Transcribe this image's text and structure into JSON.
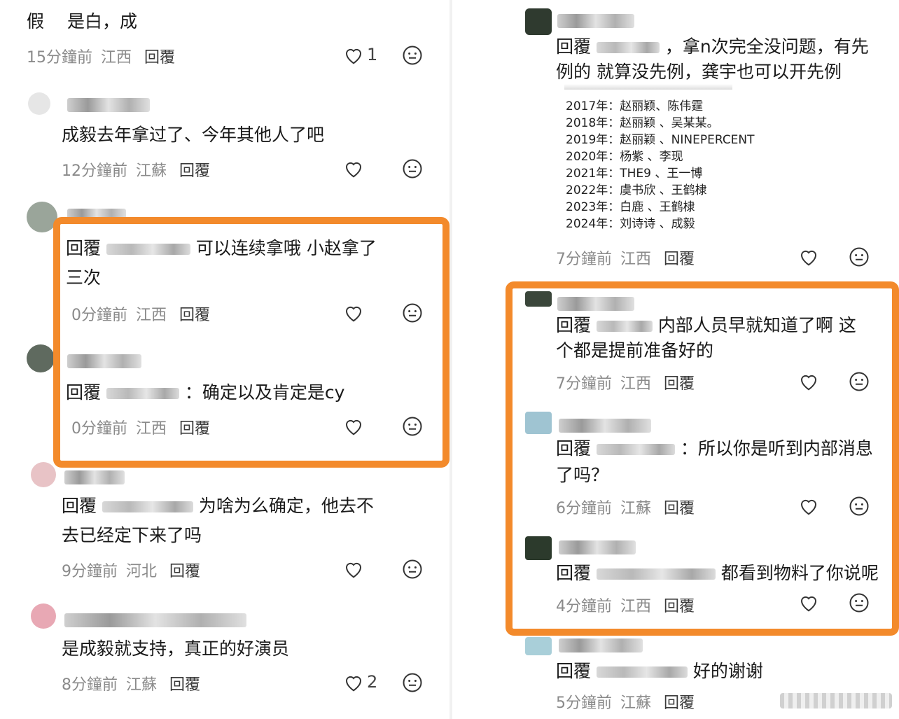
{
  "left": {
    "c1": {
      "text": "假　 是白，成",
      "time": "15分鐘前",
      "loc": "江西",
      "reply": "回覆",
      "likes": "1"
    },
    "c2": {
      "text": "成毅去年拿过了、今年其他人了吧",
      "time": "12分鐘前",
      "loc": "江蘇",
      "reply": "回覆"
    },
    "c3": {
      "prefix": "回覆",
      "text": "可以连续拿哦  小赵拿了",
      "text2": "三次",
      "time": "0分鐘前",
      "loc": "江西",
      "reply": "回覆"
    },
    "c4": {
      "prefix": "回覆",
      "text": "：确定以及肯定是cy",
      "time": "0分鐘前",
      "loc": "江西",
      "reply": "回覆"
    },
    "c5": {
      "prefix": "回覆",
      "text": "为啥为么确定，他去不",
      "text2": "去已经定下来了吗",
      "time": "9分鐘前",
      "loc": "河北",
      "reply": "回覆"
    },
    "c6": {
      "text": "是成毅就支持，真正的好演员",
      "time": "8分鐘前",
      "loc": "江蘇",
      "reply": "回覆",
      "likes": "2"
    }
  },
  "right": {
    "r1": {
      "prefix": "回覆",
      "text": "，拿n次完全没问题，有先",
      "text2": "例的  就算没先例，龚宇也可以开先例",
      "list": [
        "2017年：赵丽颖、陈伟霆",
        "2018年：赵丽颖 、吴某某。",
        "2019年：赵丽颖 、NINEPERCENT",
        "2020年：杨紫 、李现",
        "2021年：THE9 、王一博",
        "2022年：虞书欣 、王鹤棣",
        "2023年：白鹿 、王鹤棣",
        "2024年：刘诗诗 、成毅"
      ],
      "time": "7分鐘前",
      "loc": "江西",
      "reply": "回覆"
    },
    "r2": {
      "prefix": "回覆",
      "text": "内部人员早就知道了啊  这",
      "text2": "个都是提前准备好的",
      "time": "7分鐘前",
      "loc": "江西",
      "reply": "回覆"
    },
    "r3": {
      "prefix": "回覆",
      "text": "：所以你是听到内部消息",
      "text2": "了吗？",
      "time": "6分鐘前",
      "loc": "江蘇",
      "reply": "回覆"
    },
    "r4": {
      "prefix": "回覆",
      "text": "都看到物料了你说呢",
      "time": "4分鐘前",
      "loc": "江西",
      "reply": "回覆"
    },
    "r5": {
      "prefix": "回覆",
      "text": "好的谢谢",
      "time": "5分鐘前",
      "loc": "江蘇",
      "reply": "回覆"
    }
  },
  "colors": {
    "highlight": "#f38a2b",
    "meta": "#8a8a8a"
  },
  "icons": [
    "heart-icon",
    "emoji-icon"
  ]
}
